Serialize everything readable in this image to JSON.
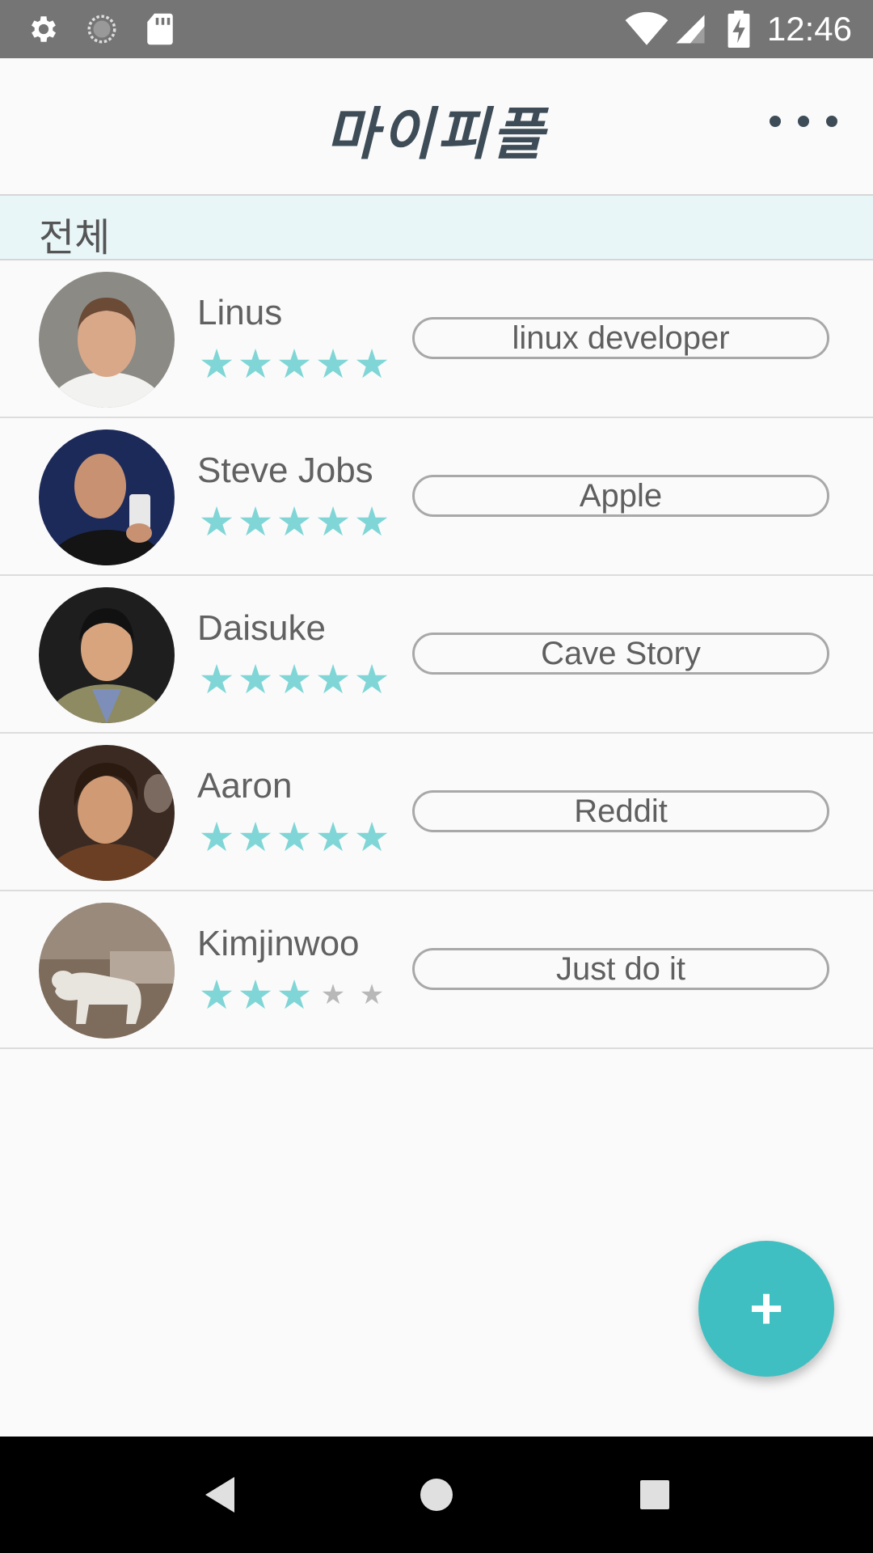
{
  "status_bar": {
    "time": "12:46",
    "icons": [
      "gear-icon",
      "sync-icon",
      "sd-card-icon",
      "wifi-icon",
      "signal-icon",
      "battery-charging-icon"
    ]
  },
  "app_bar": {
    "title": "마이피플",
    "more_icon": "more-horizontal-icon"
  },
  "section": {
    "label": "전체"
  },
  "people": [
    {
      "name": "Linus",
      "rating": 5,
      "max_rating": 5,
      "tag": "linux developer"
    },
    {
      "name": "Steve Jobs",
      "rating": 5,
      "max_rating": 5,
      "tag": "Apple"
    },
    {
      "name": "Daisuke",
      "rating": 5,
      "max_rating": 5,
      "tag": "Cave Story"
    },
    {
      "name": "Aaron",
      "rating": 5,
      "max_rating": 5,
      "tag": "Reddit"
    },
    {
      "name": "Kimjinwoo",
      "rating": 3,
      "max_rating": 5,
      "tag": "Just do it"
    }
  ],
  "fab": {
    "label": "+",
    "icon": "add-icon"
  },
  "nav_bar": {
    "icons": [
      "back-icon",
      "home-icon",
      "recents-icon"
    ]
  },
  "colors": {
    "status_bar": "#757575",
    "accent": "#3fbfc1",
    "star_on": "#80d6d6",
    "star_off": "#b8b8b8",
    "section_bg": "#e8f6f8"
  }
}
